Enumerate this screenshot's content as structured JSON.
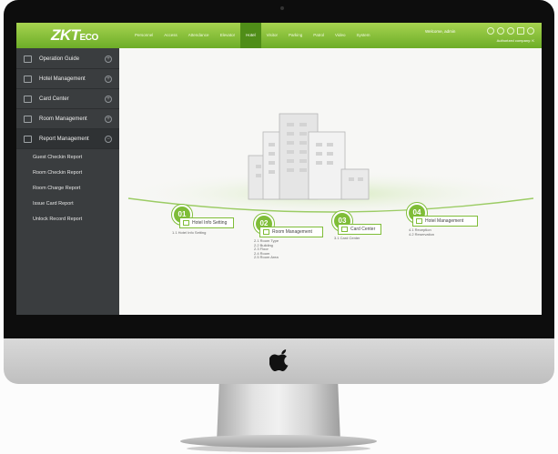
{
  "brand": {
    "logo_main": "ZKT",
    "logo_sub": "ECO"
  },
  "top_nav": {
    "items": [
      "Personnel",
      "Access",
      "Attendance",
      "Elevator",
      "Hotel",
      "Visitor",
      "Parking",
      "Patrol",
      "Video",
      "System"
    ],
    "active_index": 4
  },
  "user": {
    "greeting": "Welcome, admin",
    "authorized": "Authorized company: K"
  },
  "sidebar": {
    "items": [
      {
        "label": "Operation Guide"
      },
      {
        "label": "Hotel Management"
      },
      {
        "label": "Card Center"
      },
      {
        "label": "Room Management"
      },
      {
        "label": "Report Management"
      }
    ],
    "sub_items": [
      "Guest Checkin Report",
      "Room Checkin Report",
      "Room Charge Report",
      "Issue Card Report",
      "Unlock Record Report"
    ]
  },
  "guide": {
    "steps": [
      {
        "number": "01",
        "title": "Hotel Info Setting",
        "items": [
          "1.1 Hotel Info Setting"
        ]
      },
      {
        "number": "02",
        "title": "Room Management",
        "items": [
          "2.1 Room Type",
          "2.2 Building",
          "2.3 Floor",
          "2.4 Room",
          "2.5 Room Area"
        ]
      },
      {
        "number": "03",
        "title": "Card Center",
        "items": [
          "3.1 Card Center"
        ]
      },
      {
        "number": "04",
        "title": "Hotel Management",
        "items": [
          "4.1 Reception",
          "4.2 Reservation"
        ]
      }
    ]
  },
  "colors": {
    "accent": "#7fbd38",
    "topbar": "#6dad28",
    "sidebar": "#3a3d3f"
  }
}
